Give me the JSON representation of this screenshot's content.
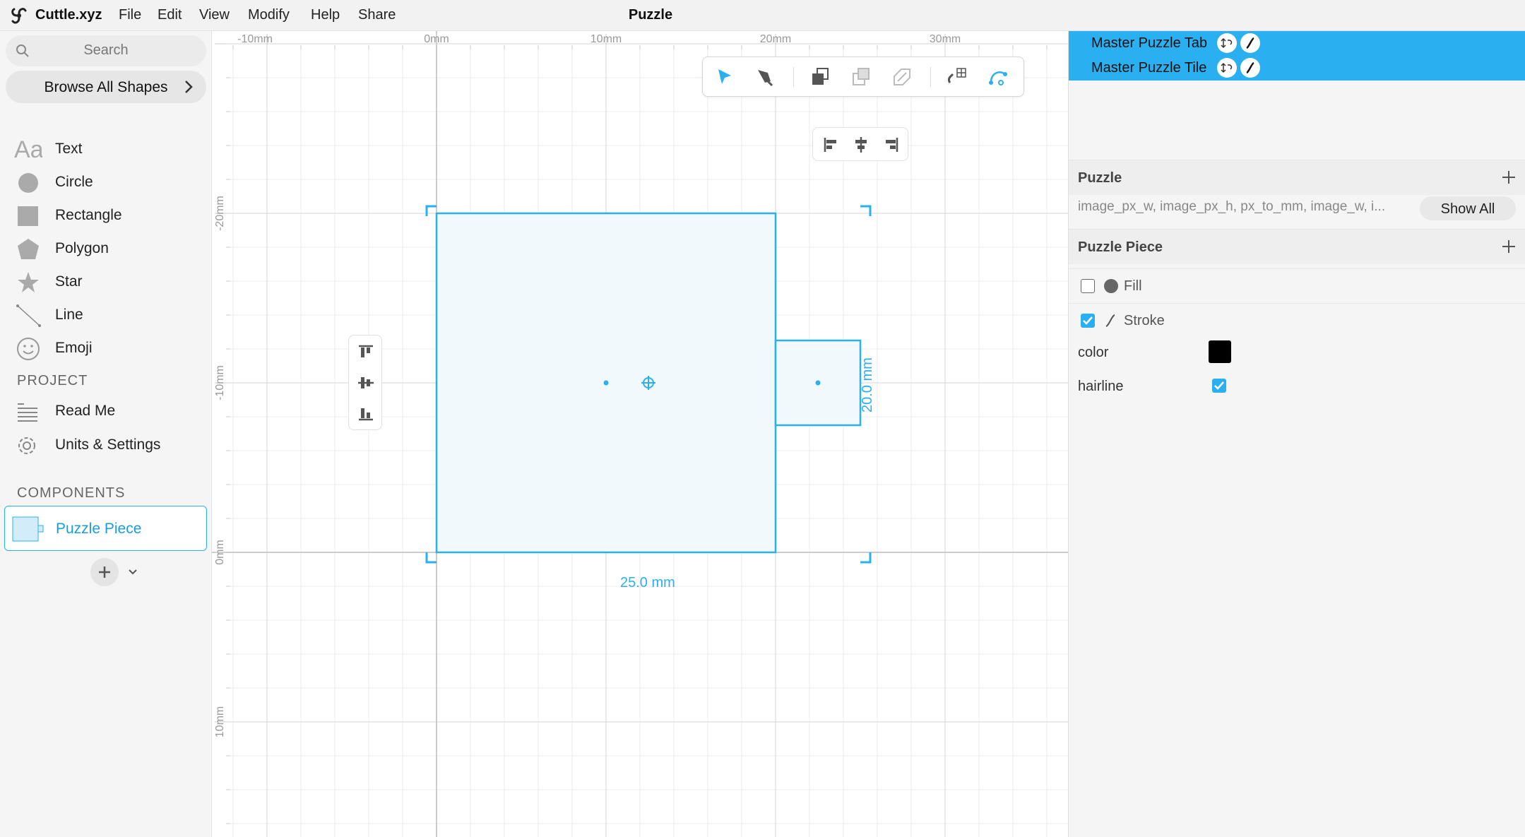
{
  "app": {
    "name": "Cuttle.xyz",
    "document_title": "Puzzle"
  },
  "menu": [
    "File",
    "Edit",
    "View",
    "Modify",
    "Help",
    "Share"
  ],
  "sidebar": {
    "search_placeholder": "Search",
    "browse_label": "Browse All Shapes",
    "shapes": [
      {
        "label": "Text",
        "icon": "text-icon"
      },
      {
        "label": "Circle",
        "icon": "circle-icon"
      },
      {
        "label": "Rectangle",
        "icon": "rectangle-icon"
      },
      {
        "label": "Polygon",
        "icon": "polygon-icon"
      },
      {
        "label": "Star",
        "icon": "star-icon"
      },
      {
        "label": "Line",
        "icon": "line-icon"
      },
      {
        "label": "Emoji",
        "icon": "emoji-icon"
      }
    ],
    "project_heading": "PROJECT",
    "project_items": [
      {
        "label": "Read Me",
        "icon": "document-lines-icon"
      },
      {
        "label": "Units & Settings",
        "icon": "gear-icon"
      }
    ],
    "components_heading": "COMPONENTS",
    "components": [
      {
        "label": "Puzzle Piece",
        "selected": true
      }
    ]
  },
  "canvas": {
    "ruler_x": [
      "-10mm",
      "0mm",
      "10mm",
      "20mm",
      "30mm"
    ],
    "ruler_y": [
      "-20mm",
      "-10mm",
      "0mm",
      "10mm"
    ],
    "width_label": "25.0 mm",
    "height_label": "20.0 mm",
    "toolbar_icons": [
      "select-arrow-icon",
      "pen-icon",
      "bring-front-icon",
      "send-back-icon",
      "layer-order-icon",
      "snap-grid-icon",
      "edit-path-icon"
    ],
    "align_h_icons": [
      "align-left-icon",
      "align-center-icon",
      "align-right-icon"
    ],
    "align_v_icons": [
      "align-top-icon",
      "align-middle-icon",
      "align-bottom-icon"
    ]
  },
  "right_panel": {
    "layers": [
      {
        "label": "Master Puzzle Tab"
      },
      {
        "label": "Master Puzzle Tile"
      }
    ],
    "puzzle": {
      "heading": "Puzzle",
      "params_text": "image_px_w, image_px_h, px_to_mm, image_w, i...",
      "show_all_label": "Show All"
    },
    "puzzle_piece": {
      "heading": "Puzzle Piece",
      "fill_label": "Fill",
      "fill_checked": false,
      "stroke_label": "Stroke",
      "stroke_checked": true,
      "color_label": "color",
      "color_value": "#000000",
      "hairline_label": "hairline",
      "hairline_checked": true
    }
  },
  "colors": {
    "accent": "#2ab0f0",
    "shape_fill": "#f1f9fd",
    "panel_bg": "#f5f5f5"
  }
}
